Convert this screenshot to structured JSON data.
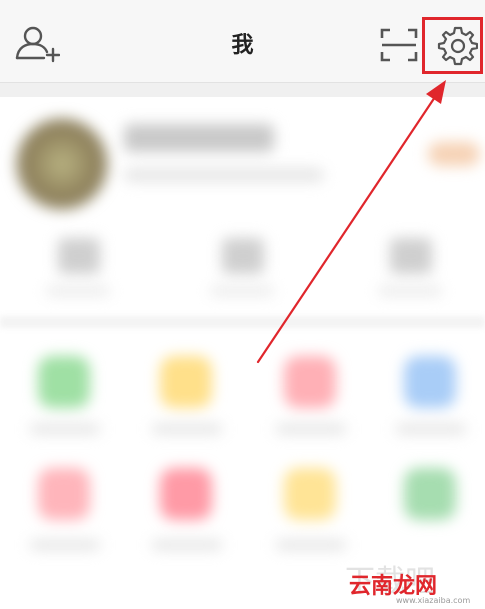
{
  "header": {
    "title": "我"
  },
  "icons": {
    "add_friend": "add-friend-icon",
    "scan": "scan-icon",
    "settings": "gear-icon"
  },
  "colors": {
    "highlight": "#e0262c",
    "topbar_bg": "#f7f7f7",
    "icon": "#555555"
  },
  "watermark": {
    "brand": "云南龙网",
    "url": "www.xiazaiba.com"
  }
}
